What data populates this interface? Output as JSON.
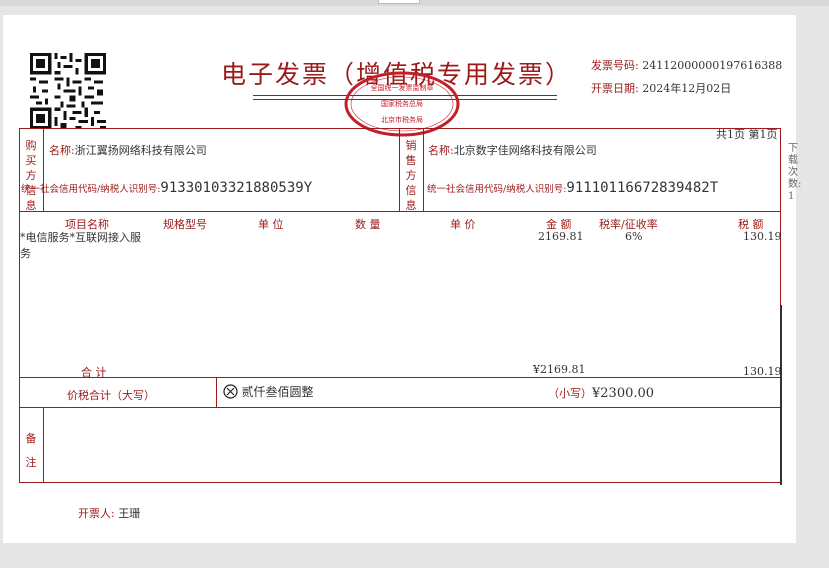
{
  "invoice": {
    "title": "电子发票（增值税专用发票）",
    "number_label": "发票号码:",
    "number_value": "24112000000197616388",
    "date_label": "开票日期:",
    "date_value": "2024年12月02日",
    "page_info": "共1页  第1页",
    "side_note": "下载次数: 1"
  },
  "seal": {
    "top_text": "全国统一发票监制章",
    "middle_text": "国家税务总局",
    "bottom_text": "北京市税务局"
  },
  "buyer": {
    "section_label": "购买方信息",
    "name_label": "名称:",
    "name_value": "浙江翼扬网络科技有限公司",
    "tax_label": "统一社会信用代码/纳税人识别号:",
    "tax_value": "91330103321880539Y"
  },
  "seller": {
    "section_label": "销售方信息",
    "name_label": "名称:",
    "name_value": "北京数字佳网络科技有限公司",
    "tax_label": "统一社会信用代码/纳税人识别号:",
    "tax_value": "91110116672839482T"
  },
  "items_header": {
    "name": "项目名称",
    "spec": "规格型号",
    "unit": "单  位",
    "qty": "数  量",
    "price": "单  价",
    "amount": "金  额",
    "rate": "税率/征收率",
    "tax": "税  额"
  },
  "items": [
    {
      "name_line1": "*电信服务*互联网接入服",
      "name_line2": "务",
      "amount": "2169.81",
      "rate": "6%",
      "tax": "130.19"
    }
  ],
  "totals": {
    "label": "合       计",
    "amount": "¥2169.81",
    "tax": "130.19"
  },
  "grand_total": {
    "label": "价税合计（大写）",
    "words": "贰仟叁佰圆整",
    "small_label": "（小写）",
    "small_value": "¥2300.00"
  },
  "remarks": {
    "label": "备注"
  },
  "issuer": {
    "label": "开票人:",
    "name": "王珊"
  },
  "colors": {
    "accent": "#9c1a1a",
    "seal": "#c41e2a"
  }
}
